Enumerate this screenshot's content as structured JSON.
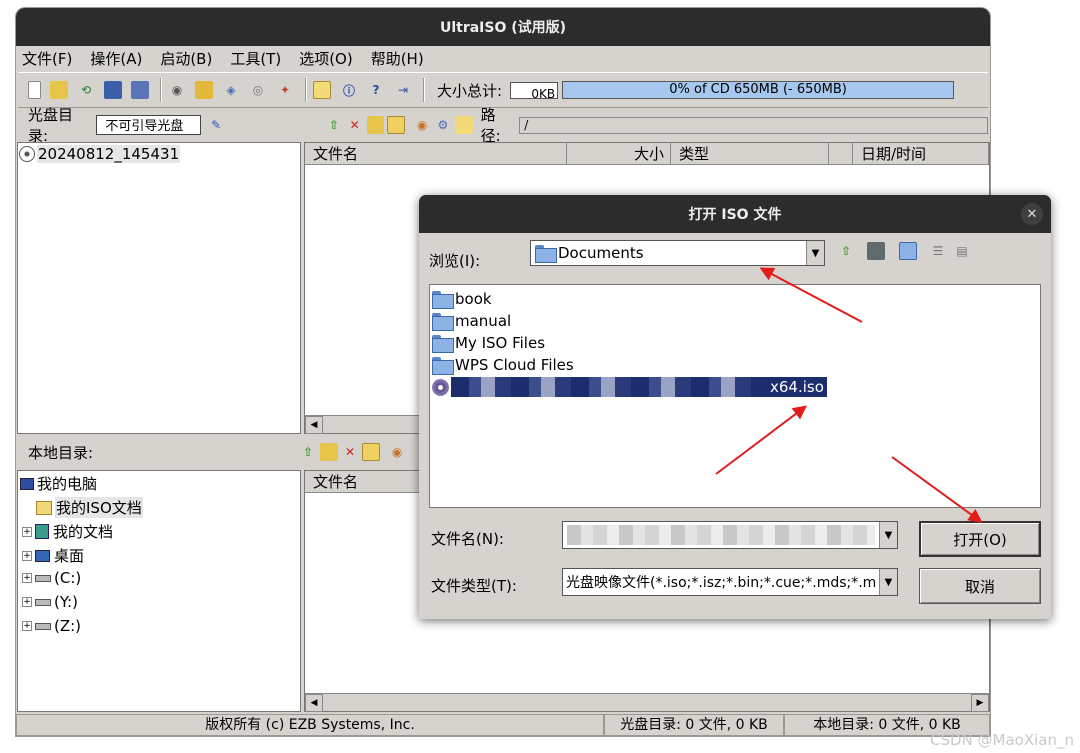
{
  "app": {
    "title": "UltraISO (试用版)"
  },
  "menu": [
    "文件(F)",
    "操作(A)",
    "启动(B)",
    "工具(T)",
    "选项(O)",
    "帮助(H)"
  ],
  "toolbar": {
    "size_label": "大小总计:",
    "size_value": "0KB",
    "capacity_text": "0% of CD 650MB (- 650MB)",
    "capacity_percent": 0
  },
  "disc": {
    "label": "光盘目录:",
    "boot_value": "不可引导光盘",
    "path_label": "路径:",
    "path_value": "/",
    "root_node": "20240812_145431"
  },
  "disc_columns": [
    "文件名",
    "大小",
    "类型",
    "日期/时间"
  ],
  "local": {
    "label": "本地目录:",
    "column": "文件名"
  },
  "local_tree": [
    "我的电脑",
    "我的ISO文档",
    "我的文档",
    "桌面",
    "(C:)",
    "(Y:)",
    "(Z:)"
  ],
  "status": {
    "copyright": "版权所有 (c) EZB Systems, Inc.",
    "disc_stat": "光盘目录: 0 文件, 0 KB",
    "local_stat": "本地目录: 0 文件, 0 KB"
  },
  "dialog": {
    "title": "打开 ISO 文件",
    "browse_label": "浏览(I):",
    "browse_value": "Documents",
    "items": [
      "book",
      "manual",
      "My ISO Files",
      "WPS Cloud Files"
    ],
    "selected_iso_suffix": "x64.iso",
    "filename_label": "文件名(N):",
    "filetype_label": "文件类型(T):",
    "filetype_value": "光盘映像文件(*.iso;*.isz;*.bin;*.cue;*.mds;*.m",
    "open_button": "打开(O)",
    "cancel_button": "取消"
  },
  "watermark": "CSDN @MaoXian_n",
  "colors": {
    "titlebar": "#2c2c2c",
    "window_bg": "#d6d3ce",
    "capacity_fill": "#a6c8ee",
    "annotation_arrow": "#e31b1b",
    "selection": "#1c2d6d"
  }
}
